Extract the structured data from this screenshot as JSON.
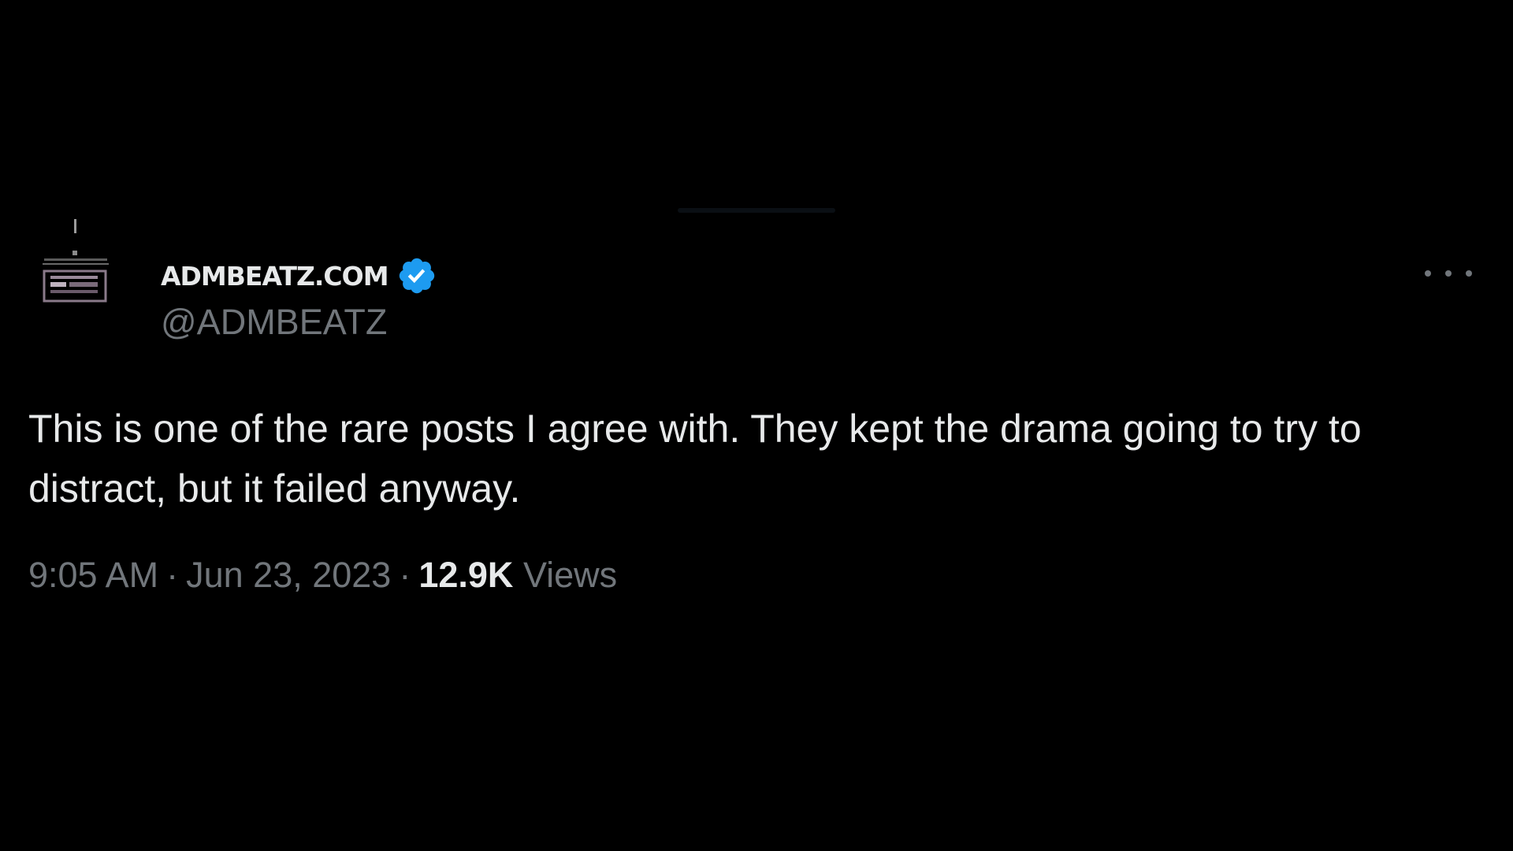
{
  "account": {
    "display_name": "ADMBEATZ.COM",
    "handle": "@ADMBEATZ",
    "verified_icon": "verified-badge-icon",
    "verified_color": "#1d9bf0"
  },
  "menu": {
    "more_icon": "more-options-icon"
  },
  "tweet": {
    "text": "This is one of the rare posts I agree with. They kept the drama going to try to distract, but it failed anyway."
  },
  "meta": {
    "time": "9:05 AM",
    "separator": "·",
    "date": "Jun 23, 2023",
    "views_count": "12.9K",
    "views_label": "Views"
  },
  "colors": {
    "background": "#000000",
    "primary_text": "#e7e9ea",
    "secondary_text": "#71767b"
  }
}
